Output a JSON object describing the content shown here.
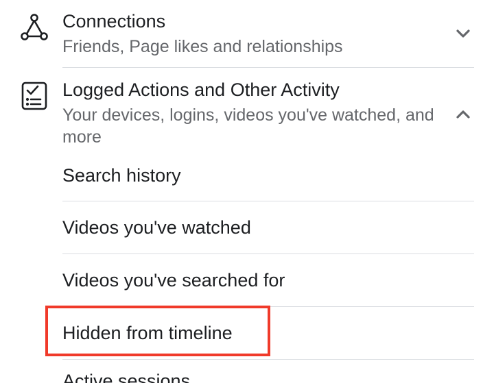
{
  "sections": [
    {
      "title": "Connections",
      "subtitle": "Friends, Page likes and relationships",
      "icon": "connections-icon",
      "state": "collapsed"
    },
    {
      "title": "Logged Actions and Other Activity",
      "subtitle": "Your devices, logins, videos you've watched, and more",
      "icon": "activity-checklist-icon",
      "state": "expanded",
      "items": [
        {
          "label": "Search history"
        },
        {
          "label": "Videos you've watched"
        },
        {
          "label": "Videos you've searched for"
        },
        {
          "label": "Hidden from timeline",
          "highlighted": true
        },
        {
          "label": "Active sessions"
        }
      ]
    }
  ],
  "colors": {
    "text_primary": "#1c1e21",
    "text_secondary": "#65676b",
    "divider": "#dadde1",
    "highlight": "#f03a2a"
  }
}
